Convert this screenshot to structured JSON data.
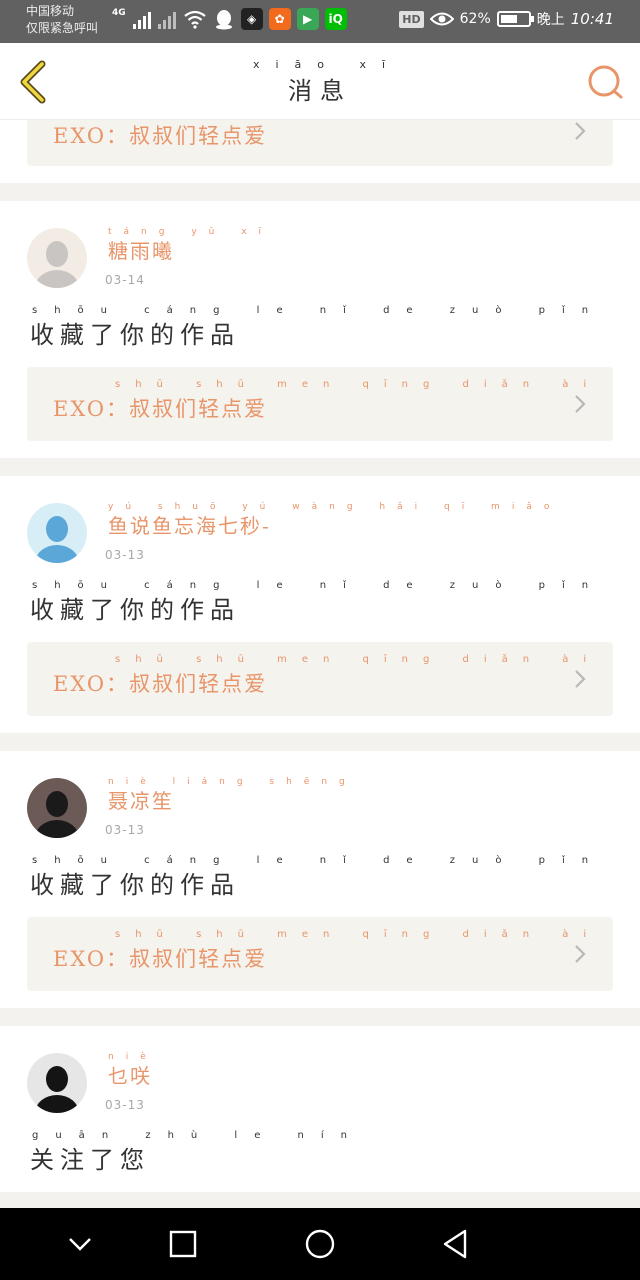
{
  "status_bar": {
    "carrier_line1": "中国移动",
    "carrier_line2": "仅限紧急呼叫",
    "network": "4G",
    "battery": "62%",
    "battery_level": 0.62,
    "time_prefix": "晚上",
    "time": "10:41",
    "hd": "HD",
    "app_icons": [
      {
        "name": "game-app-icon",
        "color": "#222222",
        "glyph": "◈"
      },
      {
        "name": "shop-app-icon",
        "color": "#f26b1d",
        "glyph": "✿"
      },
      {
        "name": "play-app-icon",
        "color": "#3aa757",
        "glyph": "▶"
      },
      {
        "name": "iqiyi-app-icon",
        "color": "#00be06",
        "glyph": "iQ"
      }
    ]
  },
  "header": {
    "title": "消息",
    "title_pinyin": "xiāo xī",
    "back_icon": "chevron-left-icon",
    "search_icon": "search-icon",
    "accent": "#e8956a"
  },
  "top_partial": {
    "ref_text": "EXO：叔叔们轻点爱"
  },
  "messages": [
    {
      "username": "糖雨曦",
      "username_pinyin": "táng yǔ xī",
      "date": "03-14",
      "action": "收藏了你的作品",
      "action_pinyin": "shōu cáng le nǐ de zuò pǐn",
      "ref_text": "EXO：叔叔们轻点爱",
      "ref_pinyin": "shū shū men qīng diǎn ài",
      "avatar_colors": [
        "#c9c5c3",
        "#f2ece4"
      ]
    },
    {
      "username": "鱼说鱼忘海七秒-",
      "username_pinyin": "yú shuō yú wàng hǎi qī miǎo",
      "date": "03-13",
      "action": "收藏了你的作品",
      "action_pinyin": "shōu cáng le nǐ de zuò pǐn",
      "ref_text": "EXO：叔叔们轻点爱",
      "ref_pinyin": "shū shū men qīng diǎn ài",
      "avatar_colors": [
        "#5aa7d8",
        "#d8eef7"
      ]
    },
    {
      "username": "聂凉笙",
      "username_pinyin": "niè liáng shēng",
      "date": "03-13",
      "action": "收藏了你的作品",
      "action_pinyin": "shōu cáng le nǐ de zuò pǐn",
      "ref_text": "EXO：叔叔们轻点爱",
      "ref_pinyin": "shū shū men qīng diǎn ài",
      "avatar_colors": [
        "#1a1a1a",
        "#6b5a55"
      ]
    }
  ],
  "follow": {
    "username": "乜咲",
    "username_pinyin": "niè",
    "date": "03-13",
    "action": "关注了您",
    "action_pinyin": "guān zhù le nín",
    "avatar_colors": [
      "#141414",
      "#e6e6e6"
    ]
  },
  "nav_bar": {
    "icons": [
      "chevron-down-icon",
      "square-icon",
      "circle-home-icon",
      "triangle-back-icon"
    ]
  }
}
